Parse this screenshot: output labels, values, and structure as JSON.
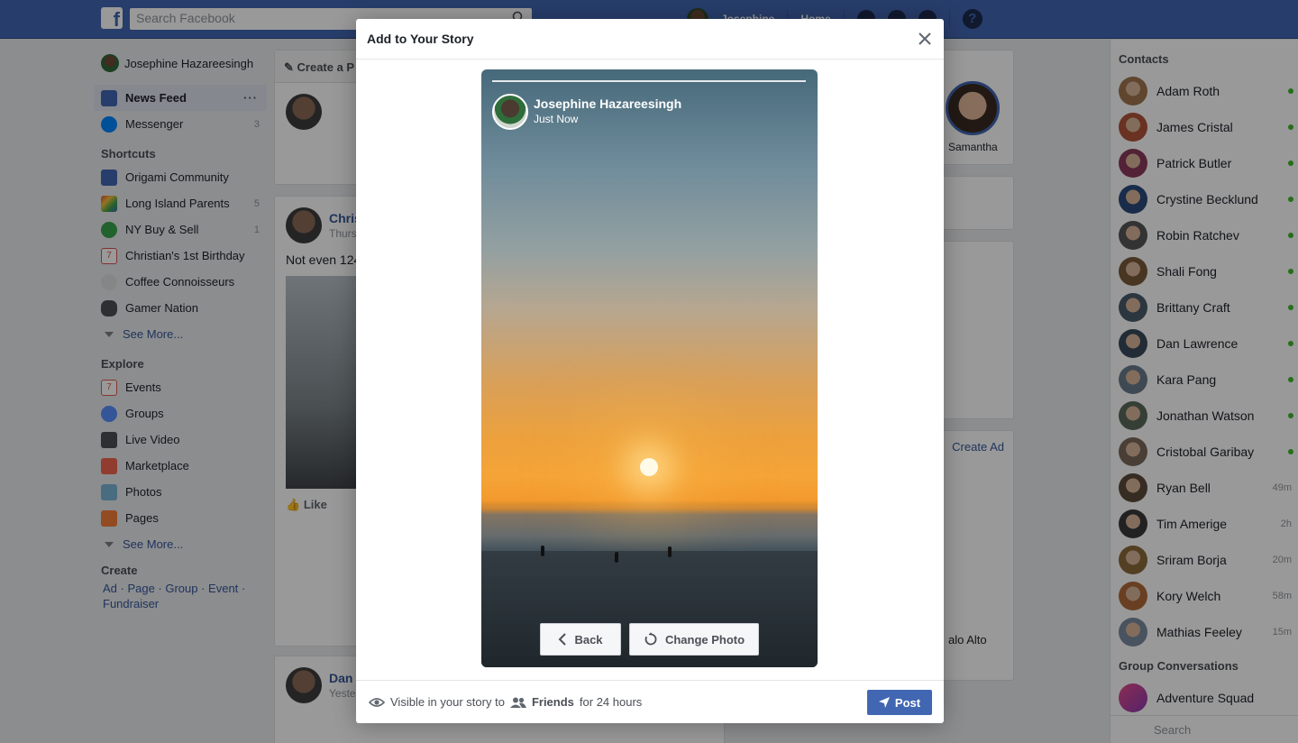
{
  "topbar": {
    "search_placeholder": "Search Facebook",
    "user_name": "Josephine",
    "home_label": "Home"
  },
  "left_nav": {
    "profile_name": "Josephine Hazareesingh",
    "main": [
      {
        "label": "News Feed",
        "count": ""
      },
      {
        "label": "Messenger",
        "count": "3"
      }
    ],
    "shortcuts_title": "Shortcuts",
    "shortcuts": [
      {
        "label": "Origami Community",
        "count": "",
        "color": "#4267b2"
      },
      {
        "label": "Long Island Parents",
        "count": "5",
        "color": "#e8a33d"
      },
      {
        "label": "NY Buy & Sell",
        "count": "1",
        "color": "#3aa34a"
      },
      {
        "label": "Christian's 1st Birthday",
        "count": "",
        "color": "#d9534f"
      },
      {
        "label": "Coffee Connoisseurs",
        "count": "",
        "color": "#b9b9b9"
      },
      {
        "label": "Gamer Nation",
        "count": "",
        "color": "#4b4f56"
      }
    ],
    "see_more": "See More...",
    "explore_title": "Explore",
    "explore": [
      {
        "label": "Events",
        "color": "#e25d4c"
      },
      {
        "label": "Groups",
        "color": "#5890ff"
      },
      {
        "label": "Live Video",
        "color": "#4b4f56"
      },
      {
        "label": "Marketplace",
        "color": "#f0654e"
      },
      {
        "label": "Photos",
        "color": "#7ab4d6"
      },
      {
        "label": "Pages",
        "color": "#f57d3a"
      }
    ],
    "see_more_2": "See More...",
    "create_title": "Create",
    "create_links": "Ad · Page · Group · Event · Fundraiser"
  },
  "feed": {
    "create_post_label": "Create a P",
    "post1": {
      "author": "Chris",
      "time": "Thurs",
      "text": "Not even 124",
      "like_label": "Like"
    },
    "post2": {
      "author": "Dan",
      "time": "Yeste"
    }
  },
  "right_mid": {
    "story_name": "Samantha",
    "create_ad": "Create Ad",
    "palo_alto": "alo Alto"
  },
  "contacts": {
    "title": "Contacts",
    "list": [
      {
        "name": "Adam Roth",
        "status": "online",
        "ago": "",
        "color": "#a0764f"
      },
      {
        "name": "James Cristal",
        "status": "online",
        "ago": "",
        "color": "#b0543a"
      },
      {
        "name": "Patrick Butler",
        "status": "online",
        "ago": "",
        "color": "#8a3a5a"
      },
      {
        "name": "Crystine Becklund",
        "status": "online",
        "ago": "",
        "color": "#2a4a7a"
      },
      {
        "name": "Robin Ratchev",
        "status": "online",
        "ago": "",
        "color": "#555555"
      },
      {
        "name": "Shali Fong",
        "status": "online",
        "ago": "",
        "color": "#7a5a3a"
      },
      {
        "name": "Brittany Craft",
        "status": "online",
        "ago": "",
        "color": "#4a5a6a"
      },
      {
        "name": "Dan Lawrence",
        "status": "online",
        "ago": "",
        "color": "#3a4a5a"
      },
      {
        "name": "Kara Pang",
        "status": "online",
        "ago": "",
        "color": "#6a7a8a"
      },
      {
        "name": "Jonathan Watson",
        "status": "online",
        "ago": "",
        "color": "#5a6a5a"
      },
      {
        "name": "Cristobal Garibay",
        "status": "online",
        "ago": "",
        "color": "#7a6a5a"
      },
      {
        "name": "Ryan Bell",
        "status": "away",
        "ago": "49m",
        "color": "#5a4a3a"
      },
      {
        "name": "Tim Amerige",
        "status": "away",
        "ago": "2h",
        "color": "#3a3a3a"
      },
      {
        "name": "Sriram Borja",
        "status": "away",
        "ago": "20m",
        "color": "#8a6a3a"
      },
      {
        "name": "Kory Welch",
        "status": "away",
        "ago": "58m",
        "color": "#b06a3a"
      },
      {
        "name": "Mathias Feeley",
        "status": "away",
        "ago": "15m",
        "color": "#7a8aa0"
      }
    ],
    "group_title": "Group Conversations",
    "group_item": "Adventure Squad",
    "search_placeholder": "Search"
  },
  "modal": {
    "title": "Add to Your Story",
    "story": {
      "name": "Josephine Hazareesingh",
      "time": "Just Now"
    },
    "back_label": "Back",
    "change_photo_label": "Change Photo",
    "footer": {
      "prefix": "Visible in your story to",
      "audience": "Friends",
      "suffix": "for 24 hours"
    },
    "post_label": "Post"
  },
  "colors": {
    "brand": "#4267b2",
    "online": "#42b72a",
    "overlay": "rgba(0,0,0,0.4)"
  }
}
